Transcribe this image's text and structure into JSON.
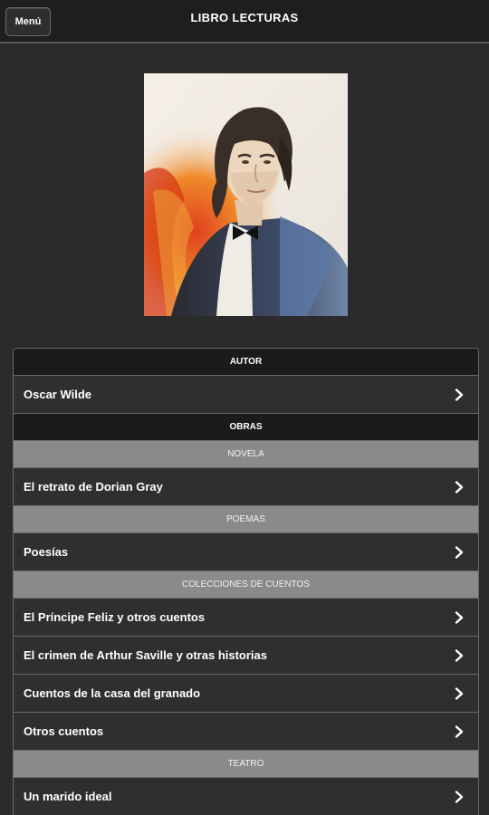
{
  "header": {
    "menu_label": "Menú",
    "title": "LIBRO LECTURAS"
  },
  "portrait": {
    "icon": "author-portrait"
  },
  "list": {
    "author_header": "AUTOR",
    "author_name": "Oscar Wilde",
    "works_header": "OBRAS",
    "novel_header": "NOVELA",
    "novel_items": [
      "El retrato de Dorian Gray"
    ],
    "poems_header": "POEMAS",
    "poems_items": [
      "Poesías"
    ],
    "stories_header": "COLECCIONES DE CUENTOS",
    "stories_items": [
      "El Príncipe Feliz y otros cuentos",
      "El crimen de Arthur Saville y otras historias",
      "Cuentos de la casa del granado",
      "Otros cuentos"
    ],
    "theatre_header": "TEATRO",
    "theatre_items": [
      "Un marido ideal"
    ]
  }
}
